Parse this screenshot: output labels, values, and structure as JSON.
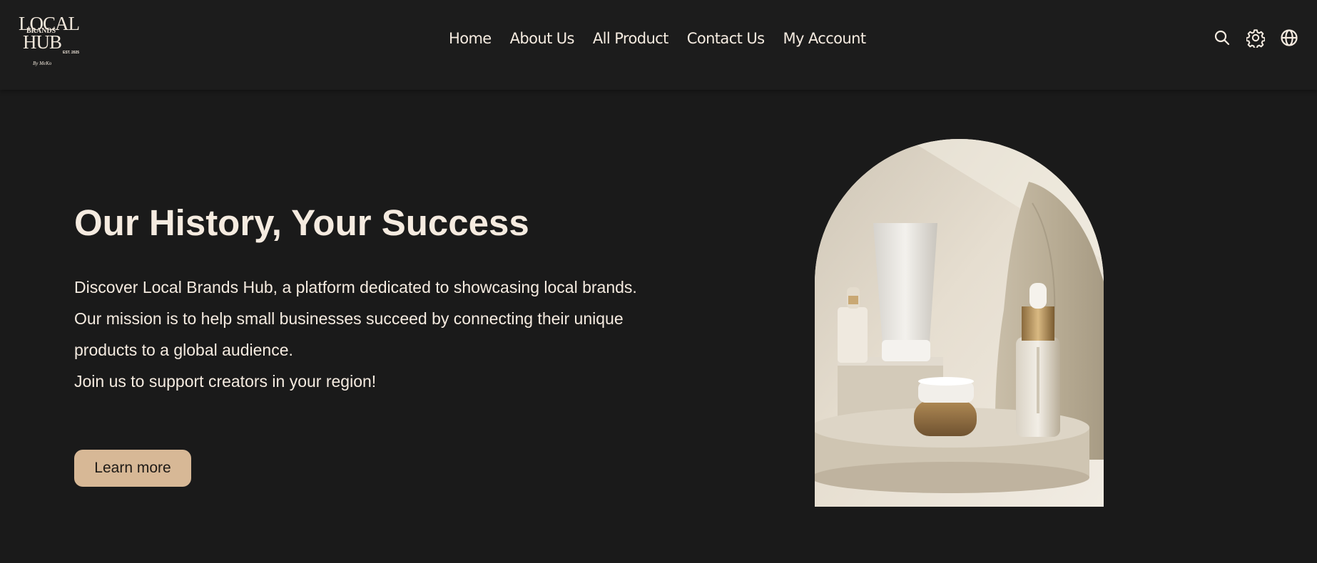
{
  "logo": {
    "line1": "LOCAL",
    "line2": "BRANDS",
    "line3": "HUB",
    "est": "EST. 2025",
    "byline": "By MeKo"
  },
  "nav": {
    "items": [
      {
        "label": "Home"
      },
      {
        "label": "About Us"
      },
      {
        "label": "All Product"
      },
      {
        "label": "Contact Us"
      },
      {
        "label": "My Account"
      }
    ]
  },
  "header_icons": [
    "search-icon",
    "settings-gear-icon",
    "globe-icon"
  ],
  "hero": {
    "title": "Our History, Your Success",
    "paragraphs": [
      "Discover Local Brands Hub, a platform dedicated to showcasing local brands.",
      "Our mission is to help small businesses succeed by connecting their unique products to a global audience.",
      "Join us to support creators in your region!"
    ],
    "button_label": "Learn more",
    "image_alt": ""
  },
  "colors": {
    "background": "#1a1a1a",
    "header_background": "#1c1c1c",
    "text": "#f5ebe0",
    "accent_button": "#d7b896"
  }
}
